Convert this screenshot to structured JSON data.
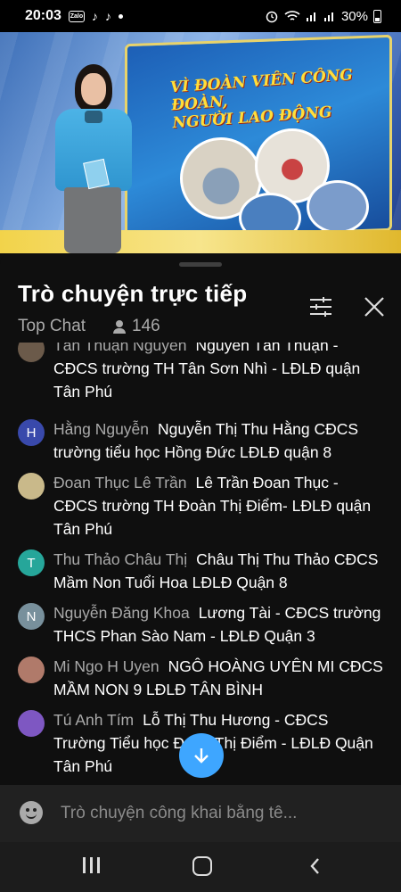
{
  "status_bar": {
    "time": "20:03",
    "zalo_label": "Zalo",
    "battery": "30%"
  },
  "video": {
    "banner_title_line1": "VÌ ĐOÀN VIÊN CÔNG ĐOÀN,",
    "banner_title_line2": "NGƯỜI LAO ĐỘNG"
  },
  "chat": {
    "title": "Trò chuyện trực tiếp",
    "mode": "Top Chat",
    "viewer_count": "146",
    "messages": [
      {
        "author": "Tân Thuận Nguyễn",
        "text": "Nguyễn Tấn Thuận - CĐCS trường TH Tân Sơn Nhì - LĐLĐ quận Tân Phú",
        "avatar_letter": "",
        "avatar_color": "#6b5a4a"
      },
      {
        "author": "Hằng Nguyễn",
        "text": "Nguyễn Thị Thu Hằng CĐCS trường tiểu học Hồng Đức LĐLĐ quận 8",
        "avatar_letter": "H",
        "avatar_color": "#3949ab"
      },
      {
        "author": "Đoan Thục Lê Trần",
        "text": "Lê Trần Đoan Thục - CĐCS trường TH Đoàn Thị Điểm- LĐLĐ quận Tân Phú",
        "avatar_letter": "",
        "avatar_color": "#c9b98a"
      },
      {
        "author": "Thu Thảo Châu Thị",
        "text": "Châu Thị Thu Thảo CĐCS Mầm Non Tuổi Hoa LĐLĐ Quận 8",
        "avatar_letter": "T",
        "avatar_color": "#26a69a"
      },
      {
        "author": "Nguyễn Đăng Khoa",
        "text": "Lương Tài - CĐCS trường THCS Phan Sào Nam - LĐLĐ Quận 3",
        "avatar_letter": "N",
        "avatar_color": "#78909c"
      },
      {
        "author": "Mi Ngo H Uyen",
        "text": "NGÔ HOÀNG UYÊN MI CĐCS MẦM NON 9 LĐLĐ TÂN BÌNH",
        "avatar_letter": "",
        "avatar_color": "#b07a6a"
      },
      {
        "author": "Tú Anh Tím",
        "text": "Lỗ Thị Thu Hương - CĐCS Trường Tiểu học Đoàn Thị Điểm - LĐLĐ Quận Tân Phú",
        "avatar_letter": "",
        "avatar_color": "#7e57c2"
      }
    ]
  },
  "composer": {
    "placeholder": "Trò chuyện công khai bằng tê..."
  },
  "colors": {
    "accent": "#3ea6ff",
    "background": "#0f0f0f",
    "author_text": "#aaaaaa"
  },
  "icons": [
    "tune-icon",
    "close-icon",
    "arrow-down-icon",
    "emoji-icon",
    "recents-icon",
    "home-icon",
    "back-icon"
  ]
}
